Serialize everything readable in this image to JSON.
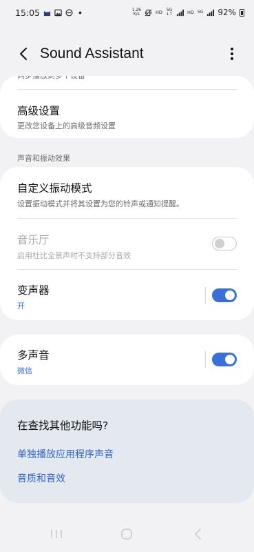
{
  "status_bar": {
    "time": "15:05",
    "net_speed_top": "1.26",
    "net_speed_bottom": "K/s",
    "hd1": "HD",
    "net1": "5G",
    "hd2": "HD",
    "net2": "5G",
    "battery": "92%"
  },
  "header": {
    "title": "Sound Assistant"
  },
  "card1": {
    "partial_text": "同步播放到多个设备",
    "advanced_title": "高级设置",
    "advanced_sub": "更改您设备上的高级音频设置"
  },
  "section": {
    "label": "声音和振动效果"
  },
  "card2": {
    "vibration_title": "自定义振动模式",
    "vibration_sub": "设置振动模式并将其设置为您的铃声或通知提醒。",
    "music_hall_title": "音乐厅",
    "music_hall_sub": "启用杜比全景声时不支持部分音效",
    "music_hall_on": false,
    "voice_changer_title": "变声器",
    "voice_changer_sub": "开",
    "voice_changer_on": true
  },
  "card3": {
    "multi_sound_title": "多声音",
    "multi_sound_sub": "微信",
    "multi_sound_on": true
  },
  "help": {
    "title": "在查找其他功能吗?",
    "link1": "单独播放应用程序声音",
    "link2": "音质和音效"
  },
  "colors": {
    "accent": "#3a6fd8",
    "background": "#f2f2f4",
    "card": "#ffffff",
    "help_card": "#e4e9f0"
  }
}
